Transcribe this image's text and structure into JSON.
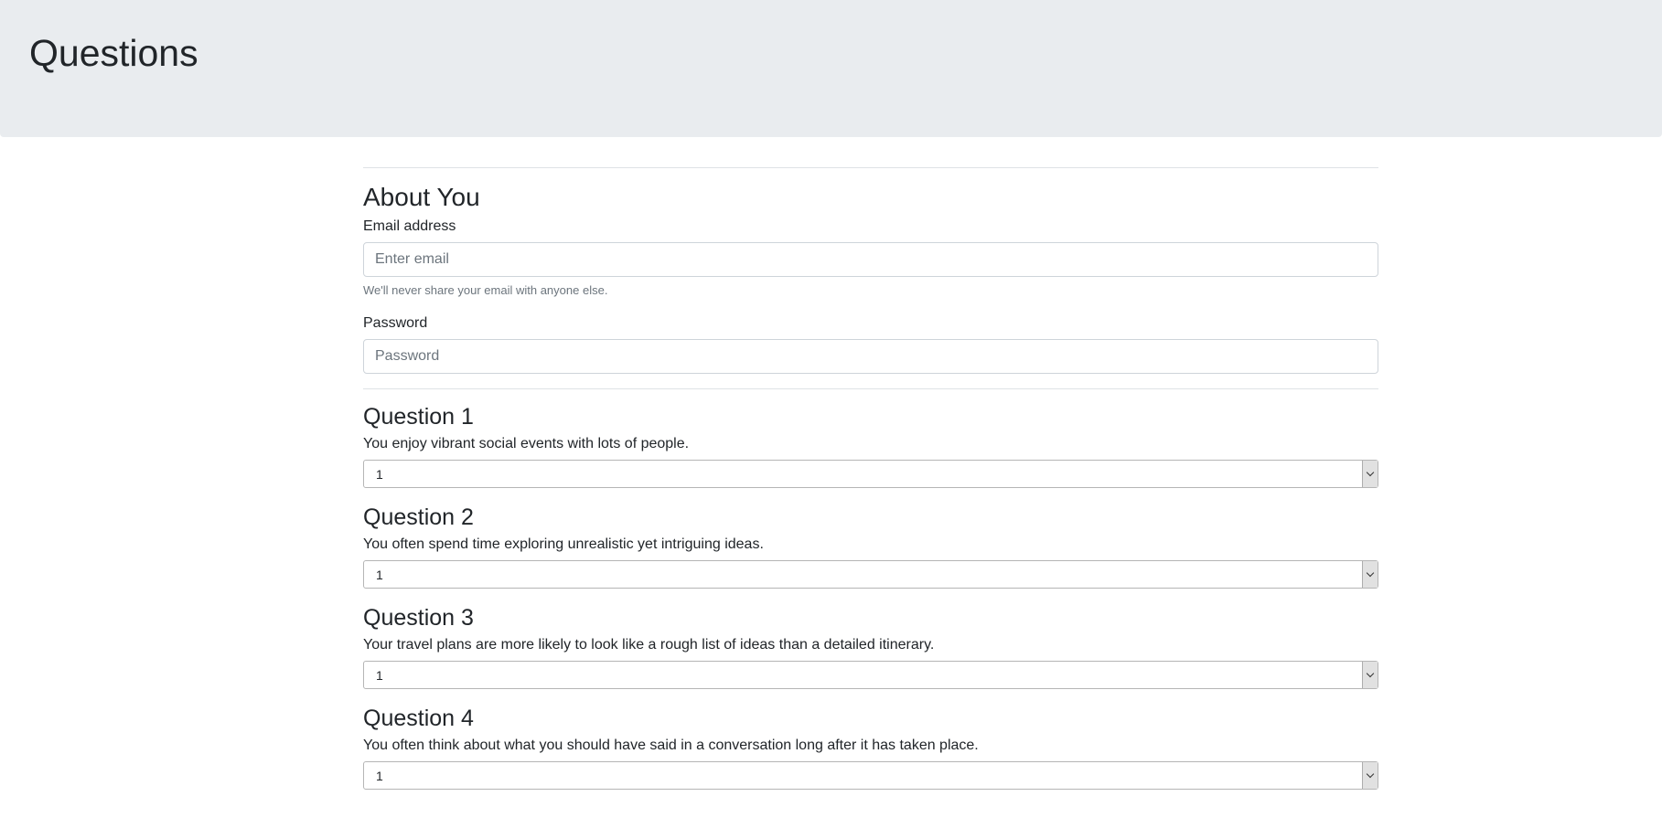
{
  "header": {
    "title": "Questions"
  },
  "about": {
    "title": "About You",
    "email": {
      "label": "Email address",
      "placeholder": "Enter email",
      "help": "We'll never share your email with anyone else."
    },
    "password": {
      "label": "Password",
      "placeholder": "Password"
    }
  },
  "questions": [
    {
      "title": "Question 1",
      "text": "You enjoy vibrant social events with lots of people.",
      "selected": "1"
    },
    {
      "title": "Question 2",
      "text": "You often spend time exploring unrealistic yet intriguing ideas.",
      "selected": "1"
    },
    {
      "title": "Question 3",
      "text": "Your travel plans are more likely to look like a rough list of ideas than a detailed itinerary.",
      "selected": "1"
    },
    {
      "title": "Question 4",
      "text": "You often think about what you should have said in a conversation long after it has taken place.",
      "selected": "1"
    }
  ]
}
